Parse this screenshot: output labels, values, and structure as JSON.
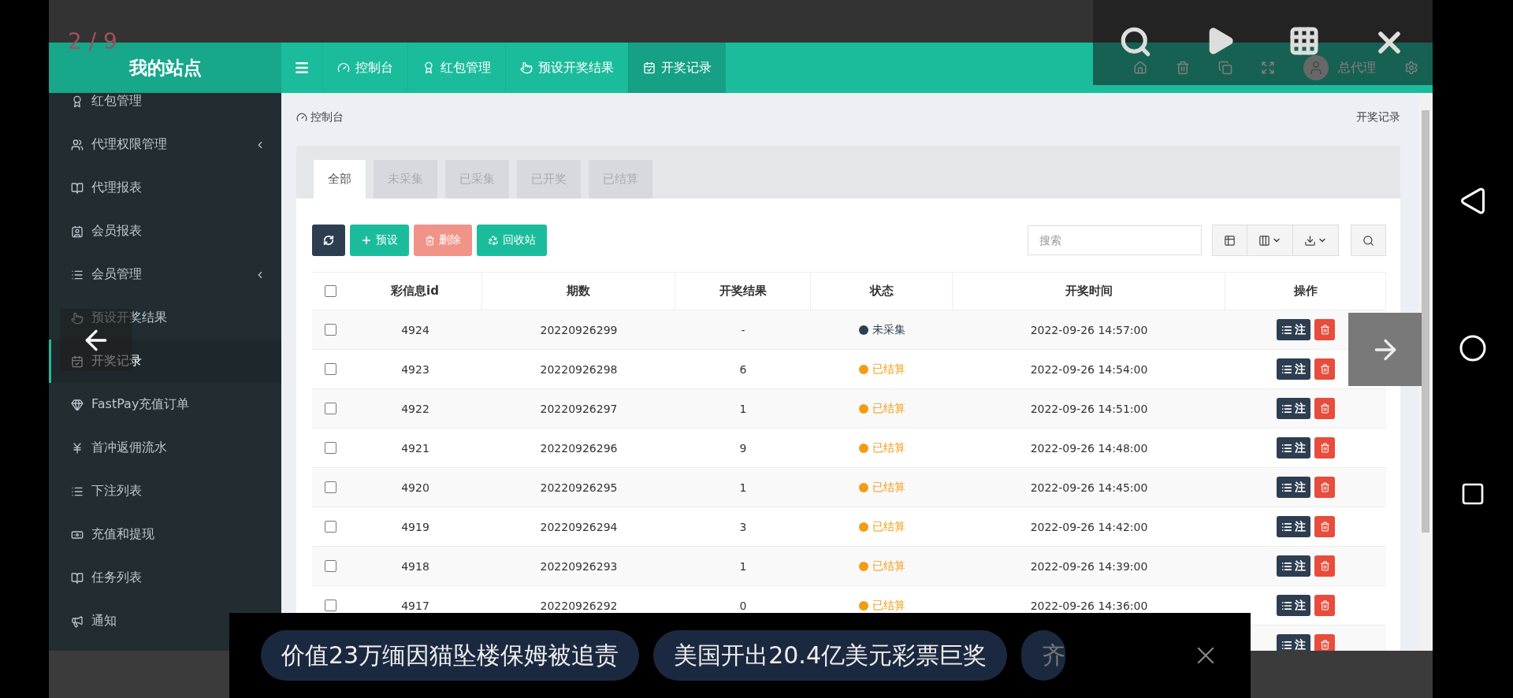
{
  "viewer": {
    "counter": "2 / 9"
  },
  "header": {
    "site_title": "我的站点",
    "user": "总代理",
    "nav": [
      {
        "label": "控制台",
        "selected": false
      },
      {
        "label": "红包管理",
        "selected": false
      },
      {
        "label": "预设开奖结果",
        "selected": false
      },
      {
        "label": "开奖记录",
        "selected": true
      }
    ]
  },
  "sidebar": {
    "items": [
      {
        "label": "红包管理",
        "selected": false,
        "has_submenu": false
      },
      {
        "label": "代理权限管理",
        "selected": false,
        "has_submenu": true
      },
      {
        "label": "代理报表",
        "selected": false,
        "has_submenu": false
      },
      {
        "label": "会员报表",
        "selected": false,
        "has_submenu": false
      },
      {
        "label": "会员管理",
        "selected": false,
        "has_submenu": true
      },
      {
        "label": "预设开奖结果",
        "selected": false,
        "has_submenu": false
      },
      {
        "label": "开奖记录",
        "selected": true,
        "has_submenu": false
      },
      {
        "label": "FastPay充值订单",
        "selected": false,
        "has_submenu": false
      },
      {
        "label": "首冲返佣流水",
        "selected": false,
        "has_submenu": false
      },
      {
        "label": "下注列表",
        "selected": false,
        "has_submenu": false
      },
      {
        "label": "充值和提现",
        "selected": false,
        "has_submenu": false
      },
      {
        "label": "任务列表",
        "selected": false,
        "has_submenu": false
      },
      {
        "label": "通知",
        "selected": false,
        "has_submenu": false
      }
    ]
  },
  "breadcrumb": {
    "current": "控制台",
    "page": "开奖记录"
  },
  "tabs": [
    {
      "label": "全部",
      "selected": true
    },
    {
      "label": "未采集",
      "selected": false
    },
    {
      "label": "已采集",
      "selected": false
    },
    {
      "label": "已开奖",
      "selected": false
    },
    {
      "label": "已结算",
      "selected": false
    }
  ],
  "toolbar": {
    "buttons": [
      {
        "kind": "refresh",
        "disabled": false
      },
      {
        "kind": "preset",
        "label": "预设",
        "disabled": false
      },
      {
        "kind": "delete",
        "label": "删除",
        "disabled": true
      },
      {
        "kind": "recycle",
        "label": "回收站",
        "disabled": false
      }
    ],
    "search": {
      "placeholder": "搜索"
    }
  },
  "table": {
    "header_checked": false,
    "columns": [
      "彩信息id",
      "期数",
      "开奖结果",
      "状态",
      "开奖时间",
      "操作"
    ],
    "rows": [
      {
        "checked": false,
        "id": "4924",
        "period": "20220926299",
        "result": "-",
        "status": "未采集",
        "color": "#2c3e50",
        "time": "2022-09-26 14:57:00",
        "note_button": "注"
      },
      {
        "checked": false,
        "id": "4923",
        "period": "20220926298",
        "result": "6",
        "status": "已结算",
        "color": "#f39c12",
        "time": "2022-09-26 14:54:00",
        "note_button": "注"
      },
      {
        "checked": false,
        "id": "4922",
        "period": "20220926297",
        "result": "1",
        "status": "已结算",
        "color": "#f39c12",
        "time": "2022-09-26 14:51:00",
        "note_button": "注"
      },
      {
        "checked": false,
        "id": "4921",
        "period": "20220926296",
        "result": "9",
        "status": "已结算",
        "color": "#f39c12",
        "time": "2022-09-26 14:48:00",
        "note_button": "注"
      },
      {
        "checked": false,
        "id": "4920",
        "period": "20220926295",
        "result": "1",
        "status": "已结算",
        "color": "#f39c12",
        "time": "2022-09-26 14:45:00",
        "note_button": "注"
      },
      {
        "checked": false,
        "id": "4919",
        "period": "20220926294",
        "result": "3",
        "status": "已结算",
        "color": "#f39c12",
        "time": "2022-09-26 14:42:00",
        "note_button": "注"
      },
      {
        "checked": false,
        "id": "4918",
        "period": "20220926293",
        "result": "1",
        "status": "已结算",
        "color": "#f39c12",
        "time": "2022-09-26 14:39:00",
        "note_button": "注"
      },
      {
        "checked": false,
        "id": "4917",
        "period": "20220926292",
        "result": "0",
        "status": "已结算",
        "color": "#f39c12",
        "time": "2022-09-26 14:36:00",
        "note_button": "注"
      },
      {
        "note_button": "注"
      }
    ]
  },
  "news": [
    "价值23万缅因猫坠楼保姆被追责",
    "美国开出20.4亿美元彩票巨奖",
    "齐"
  ]
}
